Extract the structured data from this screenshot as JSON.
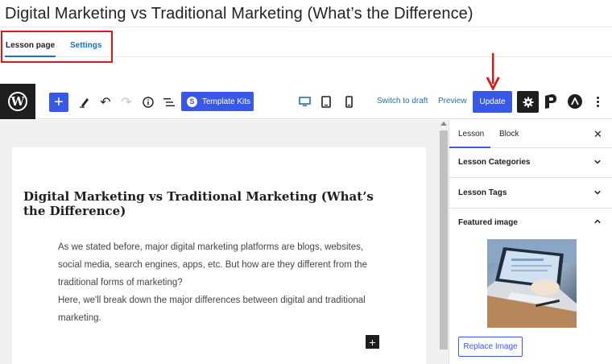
{
  "page": {
    "title": "Digital Marketing vs Traditional Marketing (What’s the Difference)"
  },
  "tabs": {
    "lesson_page": "Lesson page",
    "settings": "Settings"
  },
  "toolbar": {
    "template_kits_label": "Template Kits",
    "switch_to_draft_label": "Switch to draft",
    "preview_label": "Preview",
    "update_label": "Update",
    "icons": [
      "wordpress-logo-icon",
      "plus-icon",
      "pen-icon",
      "undo-icon",
      "redo-icon",
      "info-icon",
      "list-view-icon",
      "desktop-icon",
      "tablet-icon",
      "mobile-icon",
      "gear-icon",
      "p-logo-icon",
      "a-logo-icon",
      "more-vertical-icon"
    ]
  },
  "editor": {
    "heading": "Digital Marketing vs Traditional Marketing (What’s the Difference)",
    "paragraph_1": "As we stated before, major digital marketing platforms are blogs, websites, social media, search engines, apps, etc. But how are they different from the traditional forms of marketing?",
    "paragraph_2": "Here, we'll break down the major differences between digital and traditional marketing."
  },
  "sidebar": {
    "tabs": [
      "Lesson",
      "Block"
    ],
    "panels": [
      {
        "label": "Lesson Categories",
        "state": "collapsed"
      },
      {
        "label": "Lesson Tags",
        "state": "collapsed"
      },
      {
        "label": "Featured image",
        "state": "expanded"
      }
    ],
    "replace_image_label": "Replace Image"
  },
  "colors": {
    "accent": "#3858e9",
    "link": "#2271b1",
    "annotation_red": "#e0151b",
    "dark": "#1e1e1e"
  }
}
